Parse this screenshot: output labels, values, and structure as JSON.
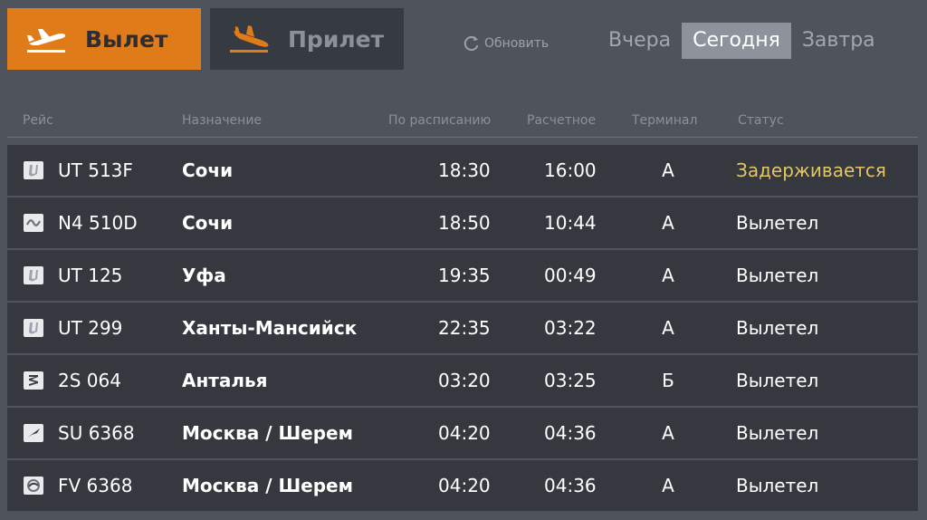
{
  "tabs": {
    "departure_label": "Вылет",
    "arrival_label": "Прилет"
  },
  "refresh_label": "Обновить",
  "days": [
    "Вчера",
    "Сегодня",
    "Завтра"
  ],
  "active_day": "Сегодня",
  "columns": {
    "flight": "Рейс",
    "destination": "Назначение",
    "scheduled": "По расписанию",
    "estimated": "Расчетное",
    "terminal": "Терминал",
    "status": "Статус"
  },
  "colors": {
    "accent": "#e07b1a",
    "delayed": "#e3c562",
    "row_bg": "#35383f",
    "page_bg": "#4e535c"
  },
  "flights": [
    {
      "airline_logo": "utair-logo",
      "flight": "UT 513F",
      "destination": "Сочи",
      "scheduled": "18:30",
      "estimated": "16:00",
      "terminal": "A",
      "status": "Задерживается"
    },
    {
      "airline_logo": "nordwind-logo",
      "flight": "N4 510D",
      "destination": "Сочи",
      "scheduled": "18:50",
      "estimated": "10:44",
      "terminal": "A",
      "status": "Вылетел"
    },
    {
      "airline_logo": "utair-logo",
      "flight": "UT 125",
      "destination": "Уфа",
      "scheduled": "19:35",
      "estimated": "00:49",
      "terminal": "A",
      "status": "Вылетел"
    },
    {
      "airline_logo": "utair-logo",
      "flight": "UT 299",
      "destination": "Ханты-Мансийск",
      "scheduled": "22:35",
      "estimated": "03:22",
      "terminal": "A",
      "status": "Вылетел"
    },
    {
      "airline_logo": "alrosa-logo",
      "flight": "2S 064",
      "destination": "Анталья",
      "scheduled": "03:20",
      "estimated": "03:25",
      "terminal": "Б",
      "status": "Вылетел"
    },
    {
      "airline_logo": "aeroflot-logo",
      "flight": "SU 6368",
      "destination": "Москва / Шерем",
      "scheduled": "04:20",
      "estimated": "04:36",
      "terminal": "A",
      "status": "Вылетел"
    },
    {
      "airline_logo": "rossiya-logo",
      "flight": "FV 6368",
      "destination": "Москва / Шерем",
      "scheduled": "04:20",
      "estimated": "04:36",
      "terminal": "A",
      "status": "Вылетел"
    }
  ]
}
